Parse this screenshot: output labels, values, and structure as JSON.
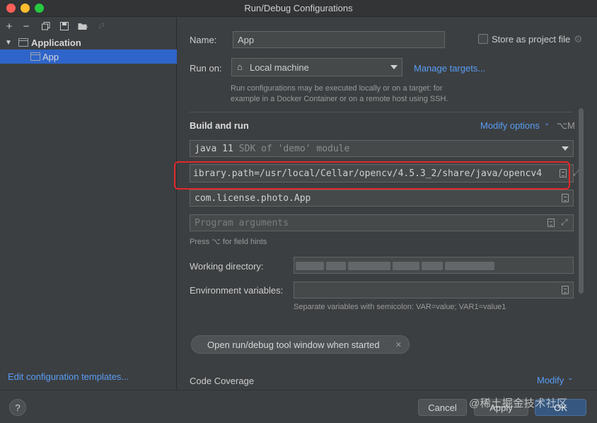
{
  "window": {
    "title": "Run/Debug Configurations"
  },
  "left": {
    "toolbar_icons": [
      "plus-icon",
      "minus-icon",
      "copy-icon",
      "save-icon",
      "folder-icon",
      "sort-icon"
    ],
    "tree": {
      "group_label": "Application",
      "child_label": "App"
    },
    "edit_templates": "Edit configuration templates..."
  },
  "right": {
    "name_label": "Name:",
    "name_value": "App",
    "store_label": "Store as project file",
    "run_on_label": "Run on:",
    "run_on_value": "Local machine",
    "manage_targets": "Manage targets...",
    "run_hint": "Run configurations may be executed locally or on a target: for example in a Docker Container or on a remote host using SSH.",
    "build_title": "Build and run",
    "modify_options": "Modify options",
    "modify_shortcut": "⌥M",
    "sdk_value": "java 11",
    "sdk_suffix": "SDK of 'demo' module",
    "vm_options_value": "ibrary.path=/usr/local/Cellar/opencv/4.5.3_2/share/java/opencv4",
    "main_class_value": "com.license.photo.App",
    "program_args_placeholder": "Program arguments",
    "field_hint": "Press ⌥ for field hints",
    "working_dir_label": "Working directory:",
    "env_label": "Environment variables:",
    "env_hint": "Separate variables with semicolon: VAR=value; VAR1=value1",
    "chip_label": "Open run/debug tool window when started",
    "code_coverage": "Code Coverage",
    "modify": "Modify"
  },
  "bottom": {
    "help": "?",
    "cancel": "Cancel",
    "apply": "Apply",
    "ok": "OK"
  },
  "watermark": "@稀土掘金技术社区",
  "colors": {
    "accent": "#589df6",
    "selection": "#2f65ca",
    "highlight_box": "#e3282a"
  }
}
